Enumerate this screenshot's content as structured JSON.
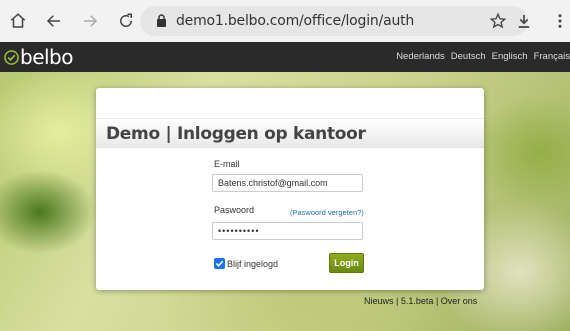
{
  "browser": {
    "url": "demo1.belbo.com/office/login/auth"
  },
  "header": {
    "logo_text": "belbo",
    "languages": [
      "Nederlands",
      "Deutsch",
      "Englisch",
      "Français"
    ]
  },
  "login": {
    "title": "Demo | Inloggen op kantoor",
    "email_label": "E-mail",
    "email_value": "Batens.christof@gmail.com",
    "password_label": "Paswoord",
    "forgot_link": "(Paswoord vergeten?)",
    "password_value": "••••••••••",
    "remember_label": "Blijf ingelogd",
    "remember_checked": true,
    "login_button": "Login"
  },
  "footer": {
    "news": "Nieuws",
    "version": "5.1.beta",
    "about": "Over ons",
    "separator": "|"
  },
  "colors": {
    "accent_green": "#7a9a14",
    "link_blue": "#1a6fc2",
    "header_bg": "#2a2a2a",
    "checkbox_blue": "#1a73e8"
  }
}
